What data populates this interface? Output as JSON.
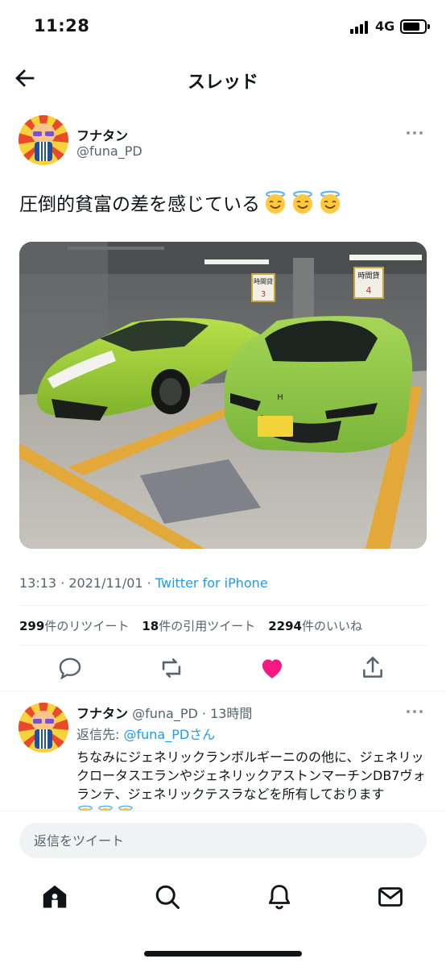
{
  "status_bar": {
    "time": "11:28",
    "network": "4G"
  },
  "header": {
    "title": "スレッド"
  },
  "tweet": {
    "author_name": "フナタン",
    "author_handle": "@funa_PD",
    "text": "圧倒的貧富の差を感じている",
    "time": "13:13",
    "date": "2021/11/01",
    "separator": " · ",
    "source": "Twitter for iPhone",
    "stats": {
      "retweets_count": "299",
      "retweets_label": "件のリツイート",
      "quotes_count": "18",
      "quotes_label": "件の引用ツイート",
      "likes_count": "2294",
      "likes_label": "件のいいね"
    },
    "photo": {
      "sign_left": "時間貸",
      "sign_left_num": "3",
      "sign_right": "時間貸",
      "sign_right_num": "4"
    }
  },
  "reply": {
    "author_name": "フナタン",
    "author_handle": "@funa_PD",
    "time": "13時間",
    "replying_to_prefix": "返信先: ",
    "replying_to_handle": "@funa_PDさん",
    "text": "ちなみにジェネリックランボルギーニのの他に、ジェネリックロータスエランやジェネリックアストンマーチンDB7ヴォランテ、ジェネリックテスラなどを所有しております"
  },
  "composer": {
    "placeholder": "返信をツイート"
  },
  "colors": {
    "accent": "#1d9bf0",
    "like": "#f91880",
    "text": "#0f1419",
    "secondary": "#536471"
  }
}
